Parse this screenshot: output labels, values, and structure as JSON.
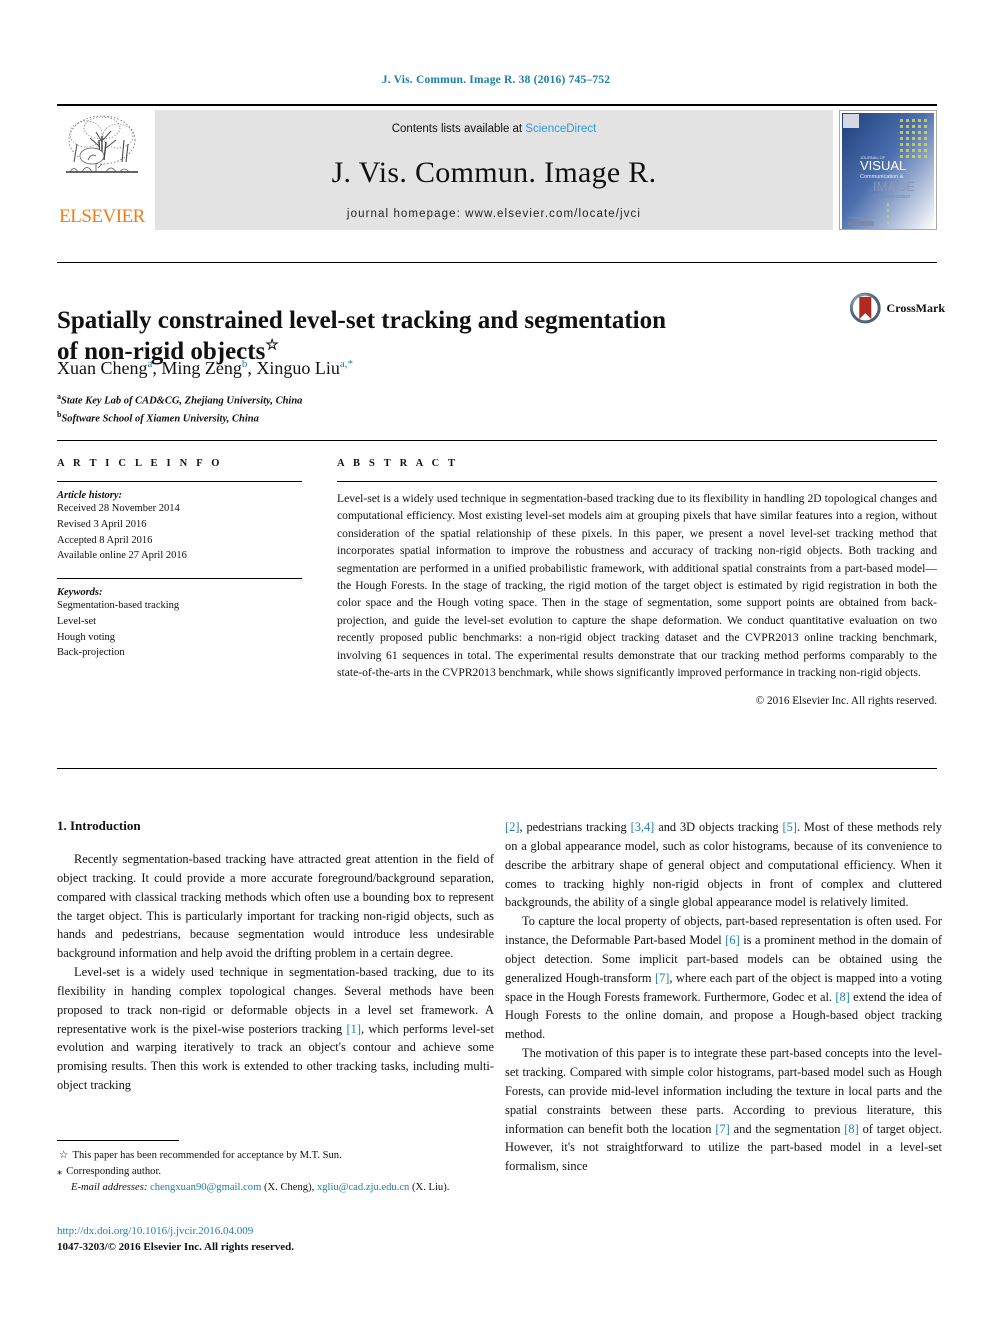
{
  "running_head": "J. Vis. Commun. Image R. 38 (2016) 745–752",
  "masthead": {
    "publisher_name": "ELSEVIER",
    "contents_prefix": "Contents lists available at ",
    "contents_link": "ScienceDirect",
    "journal_title": "J. Vis. Commun. Image R.",
    "homepage": "journal homepage: www.elsevier.com/locate/jvci",
    "cover_lines": [
      "VISUAL",
      "Communication &",
      "IMAGE",
      "Representation"
    ]
  },
  "article": {
    "title_line1": "Spatially constrained level-set tracking and segmentation",
    "title_line2": "of non-rigid objects",
    "title_footnote_mark": "☆",
    "authors": [
      {
        "name": "Xuan Cheng",
        "marks": "a",
        "sep": ", "
      },
      {
        "name": "Ming Zeng",
        "marks": "b",
        "sep": ", "
      },
      {
        "name": "Xinguo Liu",
        "marks": "a,*",
        "sep": ""
      }
    ],
    "affiliations": [
      {
        "mark": "a",
        "text": "State Key Lab of CAD&CG, Zhejiang University, China"
      },
      {
        "mark": "b",
        "text": "Software School of Xiamen University, China"
      }
    ]
  },
  "crossmark": {
    "label": "CrossMark"
  },
  "info": {
    "heading": "A R T I C L E   I N F O",
    "history_label": "Article history:",
    "history": [
      "Received 28 November 2014",
      "Revised 3 April 2016",
      "Accepted 8 April 2016",
      "Available online 27 April 2016"
    ],
    "keywords_label": "Keywords:",
    "keywords": [
      "Segmentation-based tracking",
      "Level-set",
      "Hough voting",
      "Back-projection"
    ]
  },
  "abstract": {
    "heading": "A B S T R A C T",
    "text": "Level-set is a widely used technique in segmentation-based tracking due to its flexibility in handling 2D topological changes and computational efficiency. Most existing level-set models aim at grouping pixels that have similar features into a region, without consideration of the spatial relationship of these pixels. In this paper, we present a novel level-set tracking method that incorporates spatial information to improve the robustness and accuracy of tracking non-rigid objects. Both tracking and segmentation are performed in a unified probabilistic framework, with additional spatial constraints from a part-based model—the Hough Forests. In the stage of tracking, the rigid motion of the target object is estimated by rigid registration in both the color space and the Hough voting space. Then in the stage of segmentation, some support points are obtained from back-projection, and guide the level-set evolution to capture the shape deformation. We conduct quantitative evaluation on two recently proposed public benchmarks: a non-rigid object tracking dataset and the CVPR2013 online tracking benchmark, involving 61 sequences in total. The experimental results demonstrate that our tracking method performs comparably to the state-of-the-arts in the CVPR2013 benchmark, while shows significantly improved performance in tracking non-rigid objects.",
    "copyright": "© 2016 Elsevier Inc. All rights reserved."
  },
  "body": {
    "section_heading": "1. Introduction",
    "left_paragraphs": [
      "Recently segmentation-based tracking have attracted great attention in the field of object tracking. It could provide a more accurate foreground/background separation, compared with classical tracking methods which often use a bounding box to represent the target object. This is particularly important for tracking non-rigid objects, such as hands and pedestrians, because segmentation would introduce less undesirable background information and help avoid the drifting problem in a certain degree."
    ],
    "left_para2_pre": "Level-set is a widely used technique in segmentation-based tracking, due to its flexibility in handing complex topological changes. Several methods have been proposed to track non-rigid or deformable objects in a level set framework. A representative work is the pixel-wise posteriors tracking ",
    "left_para2_ref": "[1]",
    "left_para2_post": ", which performs level-set evolution and warping iteratively to track an object's contour and achieve some promising results. Then this work is extended to other tracking tasks, including multi-object tracking",
    "right_para1": {
      "ref1": "[2]",
      "t1": ", pedestrians tracking ",
      "ref2": "[3,4]",
      "t2": " and 3D objects tracking ",
      "ref3": "[5]",
      "t3": ". Most of these methods rely on a global appearance model, such as color histograms, because of its convenience to describe the arbitrary shape of general object and computational efficiency. When it comes to tracking highly non-rigid objects in front of complex and cluttered backgrounds, the ability of a single global appearance model is relatively limited."
    },
    "right_para2": {
      "t0": "To capture the local property of objects, part-based representation is often used. For instance, the Deformable Part-based Model ",
      "ref1": "[6]",
      "t1": " is a prominent method in the domain of object detection. Some implicit part-based models can be obtained using the generalized Hough-transform ",
      "ref2": "[7]",
      "t2": ", where each part of the object is mapped into a voting space in the Hough Forests framework. Furthermore, Godec et al. ",
      "ref3": "[8]",
      "t3": " extend the idea of Hough Forests to the online domain, and propose a Hough-based object tracking method."
    },
    "right_para3": {
      "t0": "The motivation of this paper is to integrate these part-based concepts into the level-set tracking. Compared with simple color histograms, part-based model such as Hough Forests, can provide mid-level information including the texture in local parts and the spatial constraints between these parts. According to previous literature, this information can benefit both the location ",
      "ref1": "[7]",
      "t1": " and the segmentation ",
      "ref2": "[8]",
      "t2": " of target object. However, it's not straightforward to utilize the part-based model in a level-set formalism, since"
    }
  },
  "footnotes": {
    "star_symbol": "☆",
    "star_text": "This paper has been recommended for acceptance by M.T. Sun.",
    "corresponding_symbol": "⁎",
    "corresponding_text": "Corresponding author.",
    "email_label": "E-mail addresses:",
    "email1": "chengxuan90@gmail.com",
    "email1_owner": "(X. Cheng)",
    "email2": "xgliu@cad.zju.edu.cn",
    "email2_owner": "(X. Liu)."
  },
  "footer": {
    "doi": "http://dx.doi.org/10.1016/j.jvcir.2016.04.009",
    "issn_line": "1047-3203/© 2016 Elsevier Inc. All rights reserved."
  },
  "colors": {
    "link_blue": "#1f7fa8",
    "sciencedirect_blue": "#2b9cd8",
    "elsevier_orange": "#f07d18",
    "band_gray": "#e3e3e3"
  }
}
